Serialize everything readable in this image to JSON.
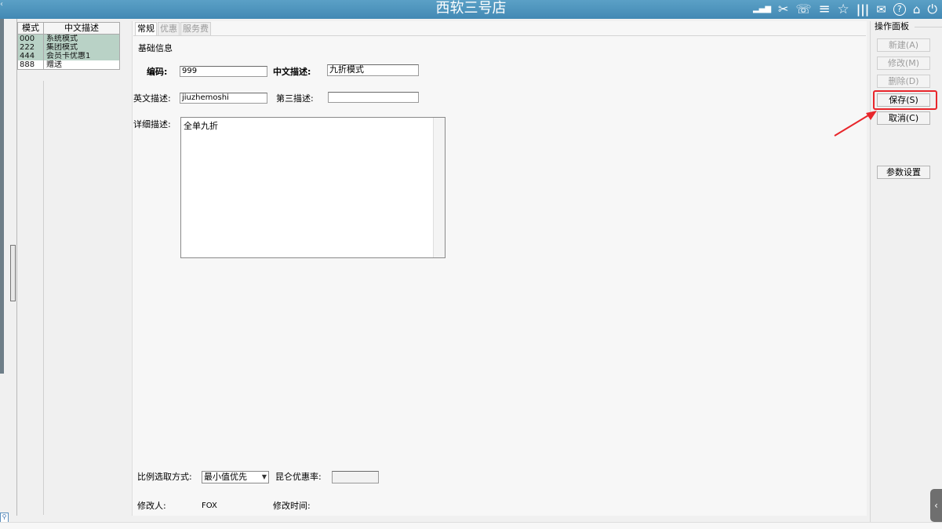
{
  "title": "西软三号店",
  "top_icons": [
    {
      "name": "signal-icon",
      "glyph": "▮"
    },
    {
      "name": "tools-icon",
      "glyph": "✂"
    },
    {
      "name": "phone-icon",
      "glyph": "☏"
    },
    {
      "name": "menu-icon",
      "glyph": "≡"
    },
    {
      "name": "star-icon",
      "glyph": "☆"
    },
    {
      "name": "bars-icon",
      "glyph": "Ⅲ"
    },
    {
      "name": "mail-icon",
      "glyph": "✉"
    },
    {
      "name": "help-icon",
      "glyph": "?"
    },
    {
      "name": "network-icon",
      "glyph": "⌂"
    },
    {
      "name": "power-icon",
      "glyph": "⏻"
    }
  ],
  "grid": {
    "headers": [
      "模式",
      "中文描述"
    ],
    "rows": [
      {
        "code": "000",
        "desc": "系统模式"
      },
      {
        "code": "222",
        "desc": "集团模式"
      },
      {
        "code": "444",
        "desc": "会员卡优惠1"
      },
      {
        "code": "888",
        "desc": "赠送"
      }
    ]
  },
  "tabs": [
    "常规",
    "优惠",
    "服务费"
  ],
  "form": {
    "section_title": "基础信息",
    "code_label": "编码:",
    "code_value": "999",
    "cn_desc_label": "中文描述:",
    "cn_desc_value": "九折模式",
    "en_desc_label": "英文描述:",
    "en_desc_value": "jiuzhemoshi",
    "third_desc_label": "第三描述:",
    "third_desc_value": "",
    "detail_label": "详细描述:",
    "detail_value": "全单九折",
    "ratio_label": "比例选取方式:",
    "ratio_value": "最小值优先",
    "kunlun_label": "昆仑优惠率:",
    "kunlun_value": "",
    "modifier_label": "修改人:",
    "modifier_value": "FOX",
    "modtime_label": "修改时间:",
    "modtime_value": ""
  },
  "panel": {
    "title": "操作面板",
    "new": "新建(A)",
    "edit": "修改(M)",
    "delete": "删除(D)",
    "save": "保存(S)",
    "cancel": "取消(C)",
    "params": "参数设置"
  },
  "colors": {
    "topbar": "#4a8fba",
    "selected_row": "#b9d2c6",
    "highlight": "#e8262b"
  }
}
